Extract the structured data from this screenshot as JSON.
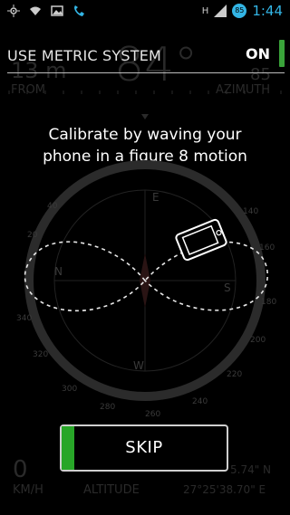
{
  "status_bar": {
    "time": "1:44",
    "battery": "85",
    "signal_label": "H"
  },
  "background": {
    "distance": "13 m",
    "distance_label": "FROM",
    "azimuth_value": "84°",
    "azimuth_label": "AZIMUTH",
    "azimuth_extra": "85",
    "speed": "0",
    "speed_label": "KM/H",
    "altitude_label": "ALTITUDE",
    "coord_n": "5.74\" N",
    "coord_e": "27°25'38.70\" E"
  },
  "metric_setting": {
    "label": "USE METRIC SYSTEM",
    "state": "ON",
    "accent": "#3aa33a"
  },
  "calibration": {
    "line1": "Calibrate by waving your",
    "line2": "phone in a figure 8 motion"
  },
  "skip_button": {
    "label": "SKIP",
    "accent": "#28a628"
  },
  "compass": {
    "letters": [
      "N",
      "E",
      "S",
      "W"
    ],
    "degrees": [
      "20",
      "40",
      "60",
      "80",
      "100",
      "120",
      "140",
      "160",
      "180",
      "200",
      "220",
      "240",
      "260",
      "280",
      "300",
      "320",
      "340"
    ]
  }
}
